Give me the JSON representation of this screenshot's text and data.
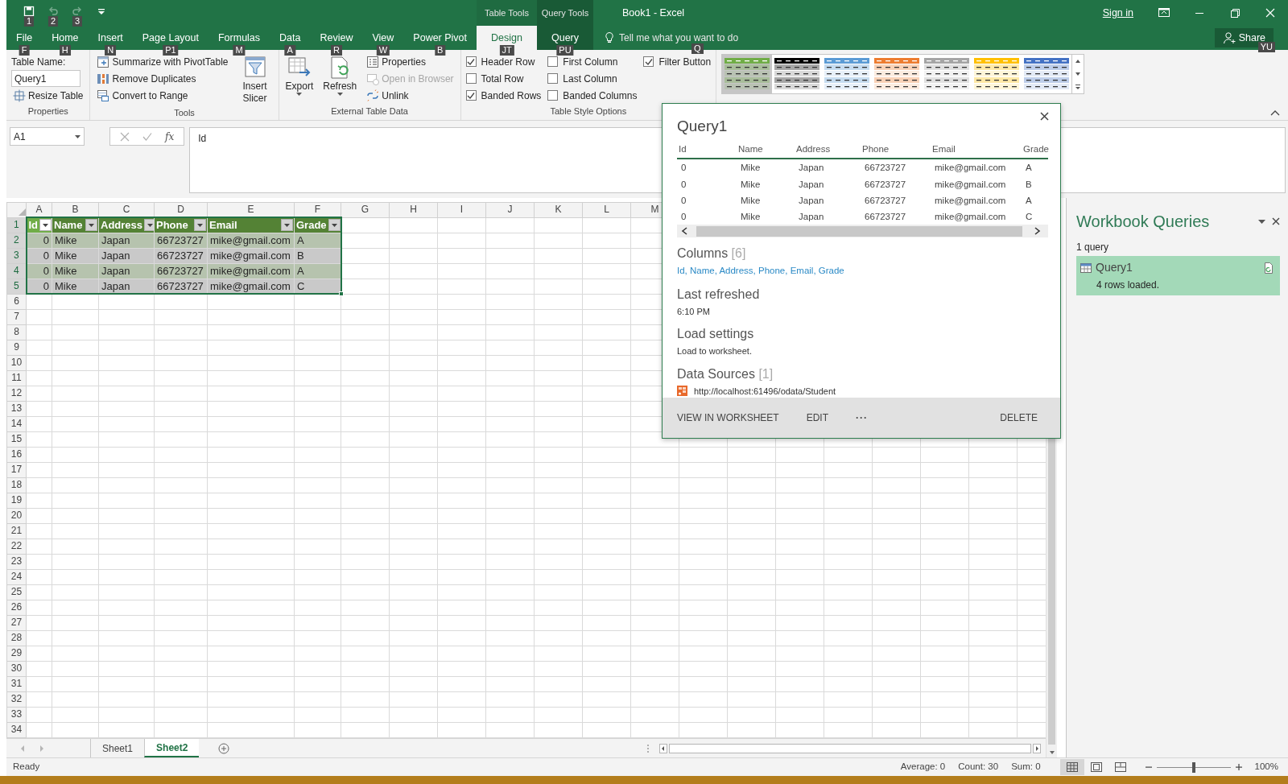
{
  "title_bar": {
    "qat": [
      {
        "kind": "save",
        "keytip": "1",
        "disabled": false
      },
      {
        "kind": "undo",
        "keytip": "2",
        "disabled": true
      },
      {
        "kind": "redo",
        "keytip": "3",
        "disabled": true
      },
      {
        "kind": "customize",
        "disabled": false
      }
    ],
    "context_groups": [
      {
        "label": "Table Tools"
      },
      {
        "label": "Query Tools"
      }
    ],
    "title": "Book1 - Excel",
    "sign_in": "Sign in"
  },
  "ribbon_tabs": [
    {
      "label": "File",
      "keytip": "F",
      "selected": false,
      "contextual": false
    },
    {
      "label": "Home",
      "keytip": "H",
      "selected": false,
      "contextual": false
    },
    {
      "label": "Insert",
      "keytip": "N",
      "selected": false,
      "contextual": false
    },
    {
      "label": "Page Layout",
      "keytip": "P1",
      "selected": false,
      "contextual": false
    },
    {
      "label": "Formulas",
      "keytip": "M",
      "selected": false,
      "contextual": false
    },
    {
      "label": "Data",
      "keytip": "A",
      "selected": false,
      "contextual": false
    },
    {
      "label": "Review",
      "keytip": "R",
      "selected": false,
      "contextual": false
    },
    {
      "label": "View",
      "keytip": "W",
      "selected": false,
      "contextual": false
    },
    {
      "label": "Power Pivot",
      "keytip": "B",
      "selected": false,
      "contextual": false
    },
    {
      "label": "Design",
      "keytip": "JT",
      "selected": true,
      "contextual": true
    },
    {
      "label": "Query",
      "keytip": "PU",
      "selected": false,
      "contextual": true
    }
  ],
  "tell_me": {
    "placeholder": "Tell me what you want to do",
    "keytip": "Q"
  },
  "share": {
    "label": "Share",
    "keytip": "YU"
  },
  "ribbon": {
    "groups": [
      {
        "label": "Properties",
        "columns": [
          [
            {
              "kind": "label",
              "text": "Table Name:"
            },
            {
              "kind": "input",
              "value": "Query1"
            },
            {
              "kind": "button",
              "label": "Resize Table",
              "disabled": false
            }
          ]
        ]
      },
      {
        "label": "Tools",
        "columns": [
          [
            {
              "kind": "button",
              "label": "Summarize with PivotTable",
              "disabled": false
            },
            {
              "kind": "button",
              "label": "Remove Duplicates",
              "disabled": false
            },
            {
              "kind": "button",
              "label": "Convert to Range",
              "disabled": false
            }
          ],
          [
            {
              "kind": "large-button",
              "label": "Insert Slicer",
              "dropdown": false
            }
          ]
        ]
      },
      {
        "label": "External Table Data",
        "columns": [
          [
            {
              "kind": "large-button",
              "label": "Export",
              "dropdown": true
            }
          ],
          [
            {
              "kind": "large-button",
              "label": "Refresh",
              "dropdown": true
            }
          ],
          [
            {
              "kind": "button",
              "label": "Properties",
              "disabled": false
            },
            {
              "kind": "button",
              "label": "Open in Browser",
              "disabled": true
            },
            {
              "kind": "button",
              "label": "Unlink",
              "disabled": false
            }
          ]
        ]
      },
      {
        "label": "Table Style Options",
        "columns": [
          [
            {
              "kind": "checkbox",
              "label": "Header Row",
              "checked": true
            },
            {
              "kind": "checkbox",
              "label": "Total Row",
              "checked": false
            },
            {
              "kind": "checkbox",
              "label": "Banded Rows",
              "checked": true
            }
          ],
          [
            {
              "kind": "checkbox",
              "label": "First Column",
              "checked": false
            },
            {
              "kind": "checkbox",
              "label": "Last Column",
              "checked": false
            },
            {
              "kind": "checkbox",
              "label": "Banded Columns",
              "checked": false
            }
          ],
          [
            {
              "kind": "checkbox",
              "label": "Filter Button",
              "checked": true
            }
          ]
        ]
      },
      {
        "columns": [
          [
            {
              "kind": "gallery",
              "styles": [
                {
                  "color": "#70ad47",
                  "selected": true
                },
                {
                  "color": "#000000",
                  "selected": false
                },
                {
                  "color": "#5b9bd5",
                  "selected": false
                },
                {
                  "color": "#ed7d31",
                  "selected": false
                },
                {
                  "color": "#a5a5a5",
                  "selected": false
                },
                {
                  "color": "#ffc000",
                  "selected": false
                },
                {
                  "color": "#4472c4",
                  "selected": false
                }
              ]
            }
          ]
        ]
      }
    ]
  },
  "formula_bar": {
    "name_box": "A1",
    "function_label": "fx",
    "formula": "Id"
  },
  "sheet": {
    "columns": [
      "A",
      "B",
      "C",
      "D",
      "E",
      "F",
      "G",
      "H",
      "I",
      "J",
      "K",
      "L",
      "M"
    ],
    "row_numbers": [
      "1",
      "2",
      "3",
      "4",
      "5",
      "6",
      "7",
      "8",
      "9",
      "10",
      "11",
      "12",
      "13",
      "14",
      "15",
      "16",
      "17",
      "18",
      "19",
      "20",
      "21",
      "22",
      "23",
      "24",
      "25",
      "26",
      "27",
      "28",
      "29",
      "30",
      "31",
      "32",
      "33",
      "34"
    ],
    "table": {
      "columns": [
        {
          "label": "Id",
          "kind": "number",
          "active": true
        },
        {
          "label": "Name",
          "kind": "text",
          "active": false
        },
        {
          "label": "Address",
          "kind": "text",
          "active": false
        },
        {
          "label": "Phone",
          "kind": "text",
          "active": false
        },
        {
          "label": "Email",
          "kind": "text",
          "active": false
        },
        {
          "label": "Grade",
          "kind": "text",
          "active": false
        }
      ],
      "rows": [
        [
          "0",
          "Mike",
          "Japan",
          "66723727",
          "mike@gmail.com",
          "A"
        ],
        [
          "0",
          "Mike",
          "Japan",
          "66723727",
          "mike@gmail.com",
          "B"
        ],
        [
          "0",
          "Mike",
          "Japan",
          "66723727",
          "mike@gmail.com",
          "A"
        ],
        [
          "0",
          "Mike",
          "Japan",
          "66723727",
          "mike@gmail.com",
          "C"
        ]
      ]
    }
  },
  "query_popup": {
    "title": "Query1",
    "preview": {
      "columns": [
        "Id",
        "Name",
        "Address",
        "Phone",
        "Email",
        "Grade"
      ],
      "rows": [
        [
          "0",
          "Mike",
          "Japan",
          "66723727",
          "mike@gmail.com",
          "A"
        ],
        [
          "0",
          "Mike",
          "Japan",
          "66723727",
          "mike@gmail.com",
          "B"
        ],
        [
          "0",
          "Mike",
          "Japan",
          "66723727",
          "mike@gmail.com",
          "A"
        ],
        [
          "0",
          "Mike",
          "Japan",
          "66723727",
          "mike@gmail.com",
          "C"
        ]
      ]
    },
    "columns_heading": "Columns",
    "columns_count": "[6]",
    "column_list": "Id, Name, Address, Phone, Email, Grade",
    "refreshed_heading": "Last refreshed",
    "refreshed": "6:10 PM",
    "load_heading": "Load settings",
    "load": "Load to worksheet.",
    "sources_heading": "Data Sources",
    "sources_count": "[1]",
    "sources": [
      "http://localhost:61496/odata/Student"
    ],
    "actions": [
      {
        "label": "VIEW IN WORKSHEET",
        "kind": "text"
      },
      {
        "label": "EDIT",
        "kind": "text"
      },
      {
        "label": "···",
        "kind": "more"
      },
      {
        "label": "DELETE",
        "kind": "end"
      }
    ]
  },
  "queries_pane": {
    "title": "Workbook Queries",
    "count": "1 query",
    "queries": [
      {
        "name": "Query1",
        "status": "4 rows loaded.",
        "selected": true
      }
    ]
  },
  "sheet_tabs": [
    {
      "label": "Sheet1",
      "selected": false
    },
    {
      "label": "Sheet2",
      "selected": true
    }
  ],
  "status_bar": {
    "ready": "Ready",
    "stats": [
      "Average: 0",
      "Count: 30",
      "Sum: 0"
    ],
    "views": [
      {
        "kind": "normal",
        "selected": true
      },
      {
        "kind": "page-layout",
        "selected": false
      },
      {
        "kind": "page-break",
        "selected": false
      }
    ],
    "zoom": {
      "level": 0.5,
      "label": "100%"
    }
  }
}
